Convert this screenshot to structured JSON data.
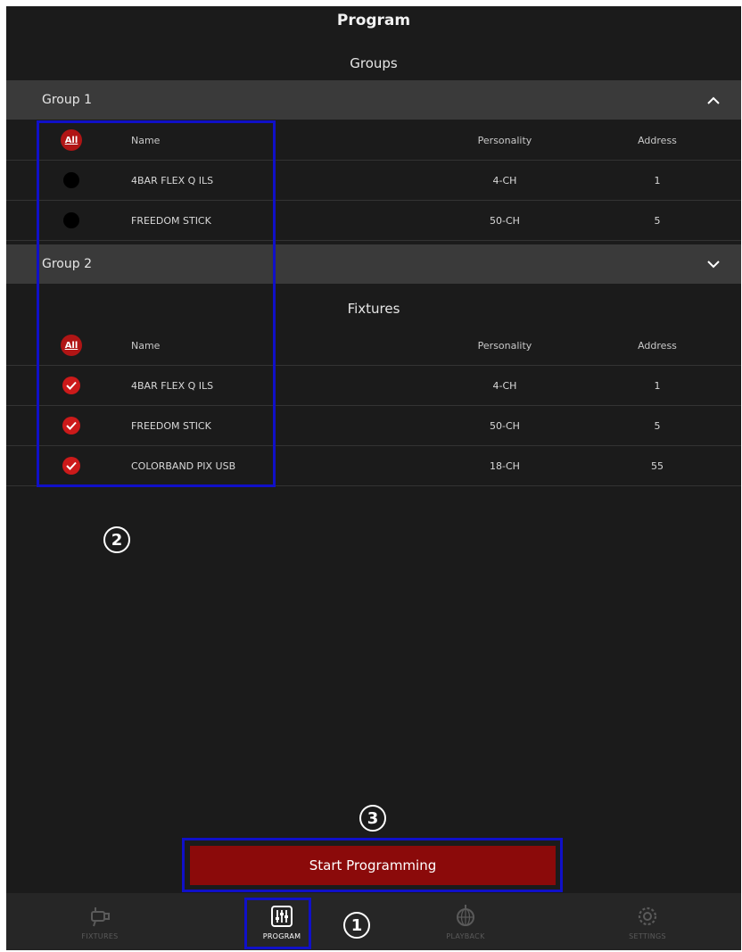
{
  "header": {
    "title": "Program"
  },
  "groups_section": {
    "title": "Groups",
    "groups": [
      {
        "label": "Group 1",
        "expanded": true
      },
      {
        "label": "Group 2",
        "expanded": false
      }
    ],
    "table_headers": {
      "select_all": "All",
      "name": "Name",
      "personality": "Personality",
      "address": "Address"
    },
    "group1_rows": [
      {
        "name": "4BAR FLEX Q ILS",
        "personality": "4-CH",
        "address": "1",
        "selected": false
      },
      {
        "name": "FREEDOM STICK",
        "personality": "50-CH",
        "address": "5",
        "selected": false
      }
    ]
  },
  "fixtures_section": {
    "title": "Fixtures",
    "table_headers": {
      "select_all": "All",
      "name": "Name",
      "personality": "Personality",
      "address": "Address"
    },
    "rows": [
      {
        "name": "4BAR FLEX Q ILS",
        "personality": "4-CH",
        "address": "1",
        "selected": true
      },
      {
        "name": "FREEDOM STICK",
        "personality": "50-CH",
        "address": "5",
        "selected": true
      },
      {
        "name": "COLORBAND PIX USB",
        "personality": "18-CH",
        "address": "55",
        "selected": true
      }
    ]
  },
  "start_button": {
    "label": "Start Programming"
  },
  "tabbar": {
    "tabs": [
      {
        "label": "FIXTURES",
        "icon": "fixture-icon",
        "active": false
      },
      {
        "label": "PROGRAM",
        "icon": "sliders-icon",
        "active": true
      },
      {
        "label": "PLAYBACK",
        "icon": "disco-ball-icon",
        "active": false
      },
      {
        "label": "SETTINGS",
        "icon": "gear-icon",
        "active": false
      }
    ]
  },
  "annotations": {
    "marker_1": "1",
    "marker_2": "2",
    "marker_3": "3"
  },
  "colors": {
    "background": "#1b1b1b",
    "accent": "#b01515",
    "button": "#8b0a0a",
    "annotation": "#1010c8"
  }
}
